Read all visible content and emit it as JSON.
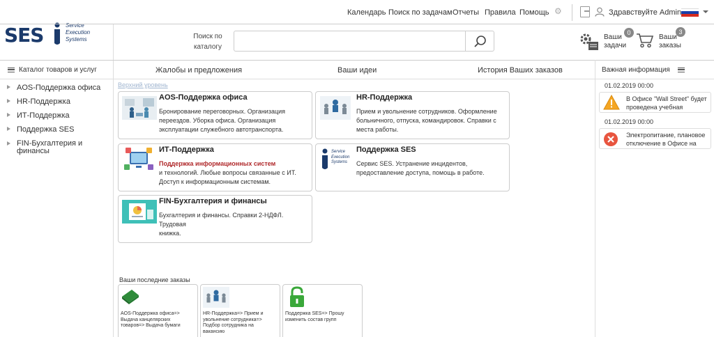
{
  "topnav": {
    "links": [
      "Календарь",
      "Поиск по задачам",
      "Отчеты",
      "Правила",
      "Помощь"
    ],
    "greeting": "Здравствуйте Admin A",
    "flag_colors": [
      "#ffffff",
      "#1a3fa8",
      "#d52b1e"
    ]
  },
  "logo": {
    "text": "SES",
    "line1": "Service",
    "line2": "Execution",
    "line3": "Systems"
  },
  "search": {
    "label_line1": "Поиск по",
    "label_line2": "каталогу",
    "placeholder": ""
  },
  "header_actions": {
    "tasks_line1": "Ваши",
    "tasks_line2": "задачи",
    "tasks_count": "0",
    "orders_line1": "Ваши",
    "orders_line2": "заказы",
    "orders_count": "3"
  },
  "catalog_header": "Каталог товаров и услуг",
  "tabs": [
    "Жалобы и предложения",
    "Ваши идеи",
    "История Ваших заказов"
  ],
  "info_header": "Важная информация",
  "sidebar": {
    "items": [
      {
        "label": "AOS-Поддержка офиса"
      },
      {
        "label": "HR-Поддержка"
      },
      {
        "label": "ИТ-Поддержка"
      },
      {
        "label": "Поддержка SES"
      },
      {
        "label_line1": "FIN-Бухгалтерия и",
        "label_line2": "финансы"
      }
    ]
  },
  "main": {
    "upper_link": "Верхний уровень",
    "cards": [
      {
        "title": "AOS-Поддержка офиса",
        "desc1": "Бронирование переговорных. Организация",
        "desc2": "переездов. Уборка офиса. Организация",
        "desc3": "эксплуатации служебного автотранспорта."
      },
      {
        "title": "HR-Поддержка",
        "desc1": "Прием и увольнение сотрудников. Оформление",
        "desc2": "больничного, отпуска, командировок. Справки с",
        "desc3": "места работы."
      },
      {
        "title": "ИТ-Поддержка",
        "highlight": "Поддержка информационных систем",
        "desc2": "и технологий. Любые вопросы связанные с ИТ.",
        "desc3": "Доступ к информационным системам."
      },
      {
        "title": "Поддержка SES",
        "desc1": "Сервис SES. Устранение инцидентов,",
        "desc2": "предоставление доступа, помощь в работе.",
        "logo_line1": "Service",
        "logo_line2": "Execution",
        "logo_line3": "Systems"
      },
      {
        "title": "FIN-Бухгалтерия и финансы",
        "desc1": "Бухгалтерия и финансы. Справки 2-НДФЛ. Трудовая",
        "desc2": "книжка."
      }
    ],
    "recent_label": "Ваши последние заказы",
    "recent": [
      {
        "l1": "AOS-Поддержка офиса=>",
        "l2": "Выдача канцелярских",
        "l3": "товаров=> Выдача бумаги",
        "l4": ""
      },
      {
        "l1": "HR-Поддержка=> Прием и",
        "l2": "увольнение сотрудника=>",
        "l3": "Подбор сотрудника на",
        "l4": "вакансию"
      },
      {
        "l1": "Поддержка SES=> Прошу",
        "l2": "изменить состав групп",
        "l3": "",
        "l4": ""
      }
    ]
  },
  "notices": [
    {
      "date": "01.02.2019 00:00",
      "text": "В Офисе \"Wall Street\" будет проведена учебная пожарная тревога",
      "type": "warning-icon"
    },
    {
      "date": "01.02.2019 00:00",
      "text": "Электропитание, плановое отключение в Офисе на",
      "type": "error-icon"
    }
  ]
}
